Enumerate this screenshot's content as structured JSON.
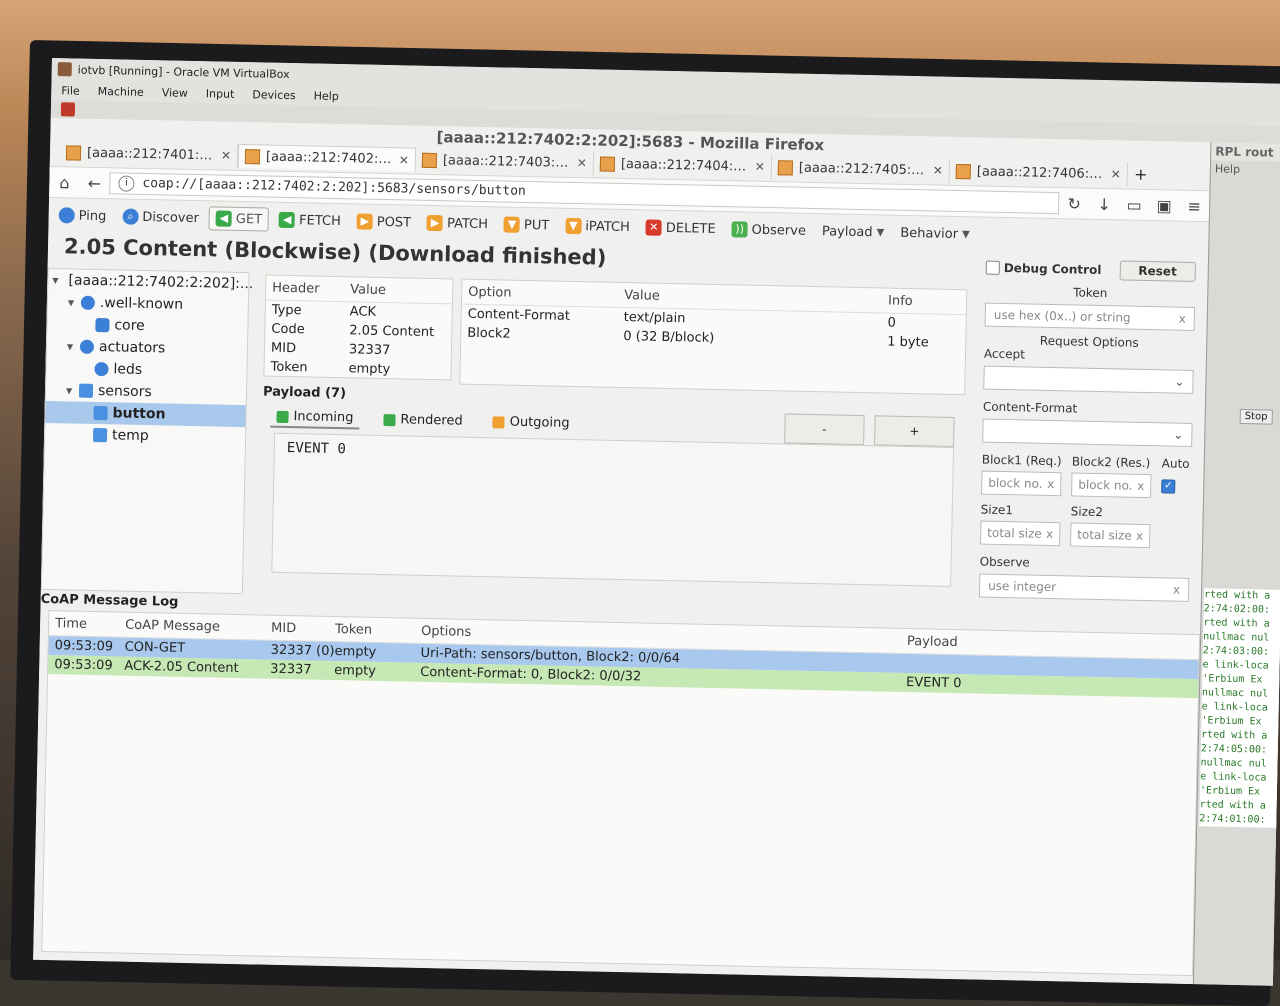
{
  "vbox": {
    "title": "iotvb [Running] - Oracle VM VirtualBox",
    "menu": [
      "File",
      "Machine",
      "View",
      "Input",
      "Devices",
      "Help"
    ]
  },
  "firefox": {
    "title": "[aaaa::212:7402:2:202]:5683 - Mozilla Firefox",
    "tabs": [
      "[aaaa::212:7401:1:1...",
      "[aaaa::212:7402:2:2...",
      "[aaaa::212:7403:3:3...",
      "[aaaa::212:7404:4:4...",
      "[aaaa::212:7405:5:5...",
      "[aaaa::212:7406:6:6..."
    ],
    "url": "coap://[aaaa::212:7402:2:202]:5683/sensors/button"
  },
  "toolbar": {
    "ping": "Ping",
    "discover": "Discover",
    "get": "GET",
    "fetch": "FETCH",
    "post": "POST",
    "patch": "PATCH",
    "put": "PUT",
    "ipatch": "iPATCH",
    "delete": "DELETE",
    "observe": "Observe",
    "payload": "Payload",
    "behavior": "Behavior"
  },
  "status": "2.05 Content (Blockwise) (Download finished)",
  "tree": {
    "root": "[aaaa::212:7402:2:202]:...",
    "wellknown": ".well-known",
    "core": "core",
    "actuators": "actuators",
    "leds": "leds",
    "sensors": "sensors",
    "button": "button",
    "temp": "temp"
  },
  "header_table": {
    "col_header": "Header",
    "col_value": "Value",
    "rows": [
      {
        "k": "Type",
        "v": "ACK"
      },
      {
        "k": "Code",
        "v": "2.05 Content"
      },
      {
        "k": "MID",
        "v": "32337"
      },
      {
        "k": "Token",
        "v": "empty"
      }
    ]
  },
  "options_table": {
    "col_option": "Option",
    "col_value": "Value",
    "col_info": "Info",
    "rows": [
      {
        "o": "Content-Format",
        "v": "text/plain",
        "i": "0"
      },
      {
        "o": "Block2",
        "v": "0 (32 B/block)",
        "i": "1 byte"
      }
    ]
  },
  "payload": {
    "title": "Payload (7)",
    "tab_incoming": "Incoming",
    "tab_rendered": "Rendered",
    "tab_outgoing": "Outgoing",
    "minus": "-",
    "plus": "+",
    "content": "EVENT 0"
  },
  "right_panel": {
    "debug": "Debug Control",
    "reset": "Reset",
    "token": "Token",
    "token_placeholder": "use hex (0x..) or string",
    "request_options": "Request Options",
    "accept": "Accept",
    "content_format": "Content-Format",
    "block1": "Block1 (Req.)",
    "block2": "Block2 (Res.)",
    "auto": "Auto",
    "block_placeholder": "block no.",
    "size1": "Size1",
    "size2": "Size2",
    "size_placeholder": "total size",
    "observe": "Observe",
    "observe_placeholder": "use integer"
  },
  "log": {
    "title": "CoAP Message Log",
    "headers": {
      "time": "Time",
      "msg": "CoAP Message",
      "mid": "MID",
      "token": "Token",
      "options": "Options",
      "payload": "Payload"
    },
    "rows": [
      {
        "time": "09:53:09",
        "msg": "CON-GET",
        "mid": "32337 (0)",
        "token": "empty",
        "options": "Uri-Path: sensors/button, Block2: 0/0/64",
        "payload": ""
      },
      {
        "time": "09:53:09",
        "msg": "ACK-2.05 Content",
        "mid": "32337",
        "token": "empty",
        "options": "Content-Format: 0, Block2: 0/0/32",
        "payload": "EVENT 0"
      }
    ]
  },
  "side_window": {
    "title": "RPL rout",
    "help": "Help",
    "stop": "Stop",
    "lines": [
      "rted with a",
      "2:74:02:00:",
      "rted with a",
      "nullmac nul",
      "2:74:03:00:",
      "e link-loca",
      "'Erbium Ex",
      "nullmac nul",
      "e link-loca",
      "'Erbium Ex",
      "rted with a",
      "2:74:05:00:",
      "nullmac nul",
      "e link-loca",
      "'Erbium Ex",
      "rted with a",
      "2:74:01:00:"
    ]
  },
  "colors": {
    "request_row": "#a9c8ee",
    "response_row": "#c6e8b4",
    "selected_tree": "#a8c8ec"
  }
}
